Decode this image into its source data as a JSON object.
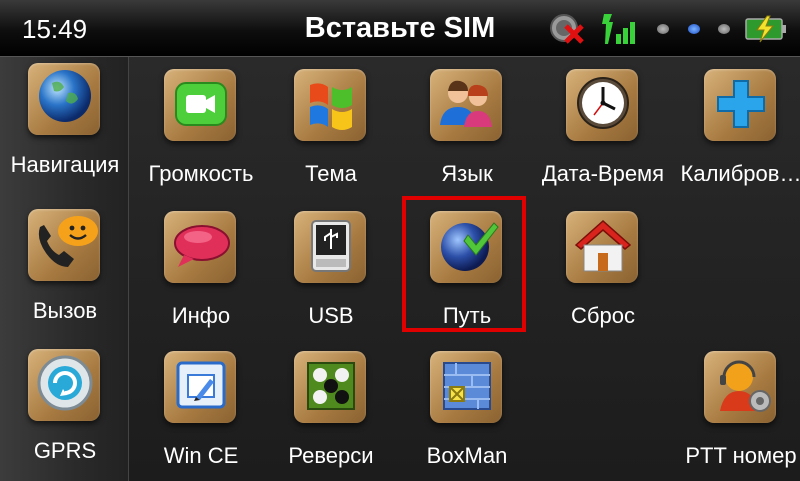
{
  "statusbar": {
    "clock": "15:49",
    "title": "Вставьте SIM",
    "icons": [
      "no-sim-icon",
      "signal-icon",
      "dot-icon",
      "dot-icon",
      "dot-icon",
      "battery-charging-icon"
    ]
  },
  "sidebar": {
    "items": [
      {
        "label": "Навигация",
        "icon": "globe-icon"
      },
      {
        "label": "Вызов",
        "icon": "phone-chat-icon"
      },
      {
        "label": "GPRS",
        "icon": "gprs-icon"
      }
    ]
  },
  "grid": {
    "row1": [
      {
        "label": "Громкость",
        "icon": "video-camera-icon"
      },
      {
        "label": "Тема",
        "icon": "windows-flag-icon"
      },
      {
        "label": "Язык",
        "icon": "people-icon"
      },
      {
        "label": "Дата-Время",
        "icon": "clock-icon"
      },
      {
        "label": "Калибров…",
        "icon": "plus-icon"
      }
    ],
    "row2": [
      {
        "label": "Инфо",
        "icon": "speech-bubble-icon"
      },
      {
        "label": "USB",
        "icon": "usb-drive-icon"
      },
      {
        "label": "Путь",
        "icon": "globe-check-icon"
      },
      {
        "label": "Сброс",
        "icon": "house-icon"
      }
    ],
    "row3": [
      {
        "label": "Win CE",
        "icon": "wince-icon"
      },
      {
        "label": "Реверси",
        "icon": "reversi-icon"
      },
      {
        "label": "BoxMan",
        "icon": "boxman-icon"
      },
      {
        "label": "PTT номер",
        "icon": "headset-user-icon"
      }
    ]
  },
  "selected": "Путь",
  "colors": {
    "highlight": "#e00000",
    "tile_wood": "#b8894d",
    "text": "#ffffff"
  }
}
